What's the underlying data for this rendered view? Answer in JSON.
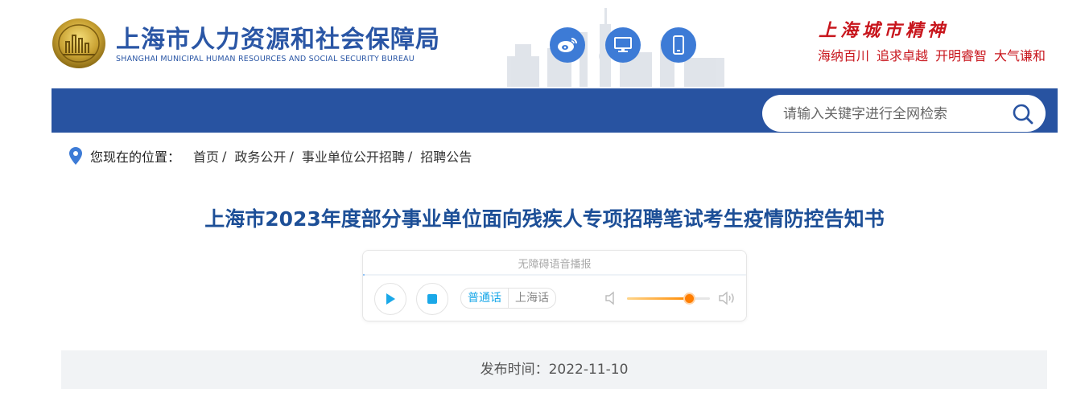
{
  "header": {
    "org_name_cn": "上海市人力资源和社会保障局",
    "org_name_en": "SHANGHAI MUNICIPAL HUMAN RESOURCES AND SOCIAL SECURITY BUREAU",
    "spirit_title": "上海城市精神",
    "spirit_mottos": [
      "海纳百川",
      "追求卓越",
      "开明睿智",
      "大气谦和"
    ],
    "icons": [
      "weibo-icon",
      "desktop-icon",
      "mobile-icon"
    ]
  },
  "search": {
    "placeholder": "请输入关键字进行全网检索"
  },
  "breadcrumb": {
    "lead": "您现在的位置：",
    "items": [
      "首页",
      "政务公开",
      "事业单位公开招聘",
      "招聘公告"
    ],
    "separator": "/"
  },
  "article": {
    "title": "上海市2023年度部分事业单位面向残疾人专项招聘笔试考生疫情防控告知书",
    "publish_label": "发布时间：2022-11-10"
  },
  "player": {
    "label": "无障碍语音播报",
    "lang_options": [
      "普通话",
      "上海话"
    ],
    "selected_lang": "普通话",
    "volume": 0.75
  },
  "colors": {
    "brand_blue": "#2853a1",
    "title_blue": "#1d4f97",
    "spirit_red": "#c8161d",
    "accent_cyan": "#1aa8e8",
    "volume_orange": "#ff7e00"
  }
}
